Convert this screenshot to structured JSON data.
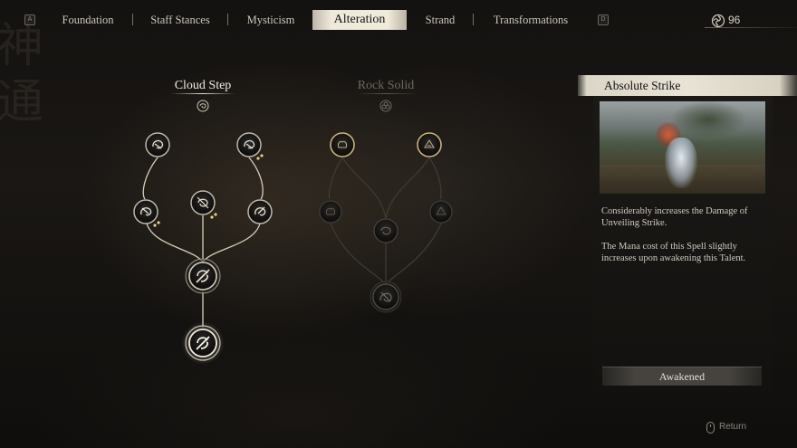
{
  "topbar": {
    "left_key": "A",
    "right_key": "D",
    "tabs": [
      {
        "label": "Foundation",
        "active": false
      },
      {
        "label": "Staff Stances",
        "active": false
      },
      {
        "label": "Mysticism",
        "active": false
      },
      {
        "label": "Alteration",
        "active": true
      },
      {
        "label": "Strand",
        "active": false
      },
      {
        "label": "Transformations",
        "active": false
      }
    ],
    "currency": {
      "icon": "spirit-swirl-icon",
      "value": "96"
    }
  },
  "trees": [
    {
      "title": "Cloud Step",
      "state": "active",
      "icon": "cloud-step-icon"
    },
    {
      "title": "Rock Solid",
      "state": "inactive",
      "icon": "rock-solid-icon"
    }
  ],
  "calligraphy": "神通",
  "detail": {
    "title": "Absolute Strike",
    "description_1": "Considerably increases the Damage of Unveiling Strike.",
    "description_2": "The Mana cost of this Spell slightly increases upon awakening this Talent.",
    "status_button": "Awakened"
  },
  "footer": {
    "return_label": "Return",
    "return_icon": "mouse-right-click-icon"
  },
  "colors": {
    "active_line": "#d8cfb8",
    "inactive_line": "#3e3a34",
    "node_gold": "#c8b27a",
    "highlight_bar": "#ece6d8"
  }
}
